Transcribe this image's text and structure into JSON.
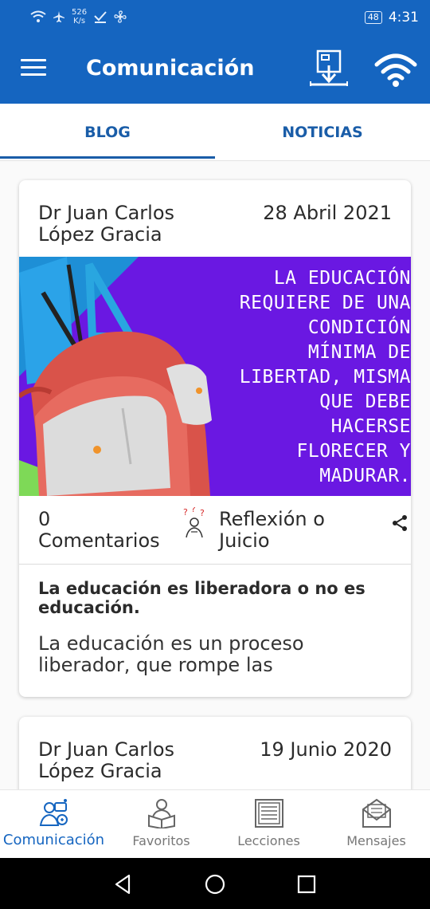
{
  "status_bar": {
    "speed_value": "526",
    "speed_unit": "K/s",
    "battery": "48",
    "time": "4:31"
  },
  "app_bar": {
    "title": "Comunicación",
    "bar_color": "#1565c0"
  },
  "tabs": [
    {
      "label": "BLOG",
      "selected": true
    },
    {
      "label": "NOTICIAS",
      "selected": false
    }
  ],
  "posts": [
    {
      "author": "Dr Juan Carlos López Gracia",
      "date": "28 Abril 2021",
      "image_quote": "LA EDUCACIÓN\nREQUIERE DE UNA\nCONDICIÓN\nMÍNIMA DE\nLIBERTAD, MISMA\nQUE DEBE\nHACERSE\nFLORECER Y\nMADURAR.",
      "comments": "0 Comentarios",
      "category": "Reflexión o Juicio",
      "title": "La educación es liberadora o no es educación.",
      "excerpt": "La educación es un proceso liberador, que rompe las"
    },
    {
      "author": "Dr Juan Carlos López Gracia",
      "date": "19 Junio 2020"
    }
  ],
  "bottom_nav": [
    {
      "label": "Comunicación",
      "icon": "communication-icon",
      "active": true
    },
    {
      "label": "Favoritos",
      "icon": "reader-icon",
      "active": false
    },
    {
      "label": "Lecciones",
      "icon": "lessons-icon",
      "active": false
    },
    {
      "label": "Mensajes",
      "icon": "envelope-icon",
      "active": false
    }
  ]
}
